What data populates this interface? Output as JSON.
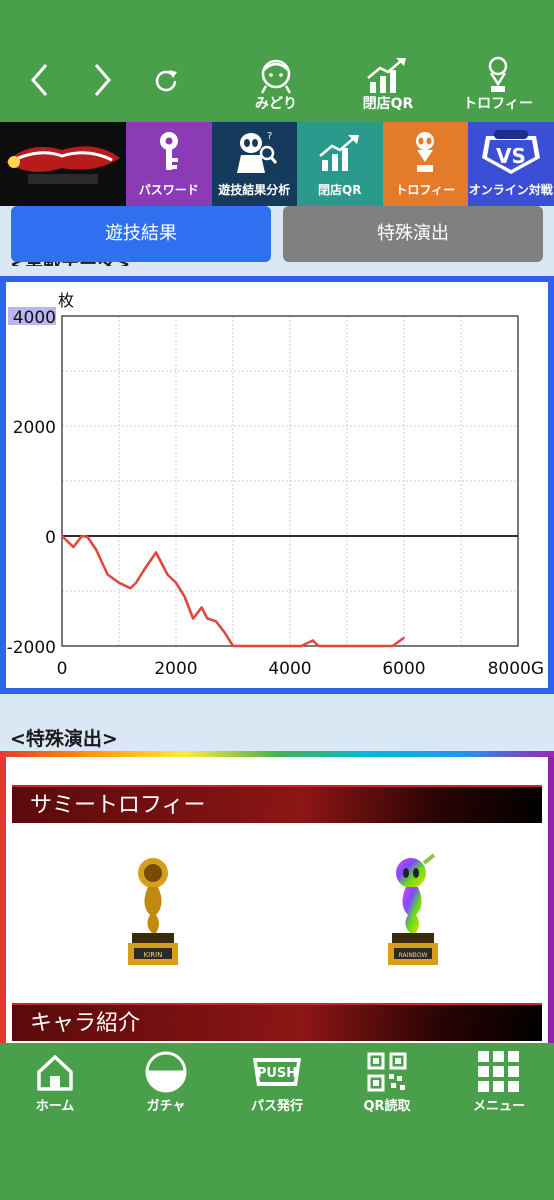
{
  "topbar": {
    "back_icon": "chevron-left-icon",
    "forward_icon": "chevron-right-icon",
    "reload_icon": "reload-icon",
    "items": [
      {
        "label": "みどり",
        "icon": "character-icon"
      },
      {
        "label": "閉店QR",
        "icon": "growth-chart-icon"
      },
      {
        "label": "トロフィー",
        "icon": "trophy-icon"
      }
    ]
  },
  "tiles": [
    {
      "label": "",
      "icon": "game-logo",
      "color": "#0d0d0d"
    },
    {
      "label": "パスワード",
      "icon": "key-icon",
      "color": "#8a3bb5"
    },
    {
      "label": "遊技結果分析",
      "icon": "alien-analysis-icon",
      "color": "#163a5c"
    },
    {
      "label": "閉店QR",
      "icon": "growth-chart-icon",
      "color": "#2a9a8c"
    },
    {
      "label": "トロフィー",
      "icon": "trophy-icon",
      "color": "#e37b2b"
    },
    {
      "label": "オンライン対戦",
      "icon": "vs-badge-icon",
      "color": "#3b4fd6"
    }
  ],
  "tabs": {
    "results": "遊技結果",
    "special": "特殊演出"
  },
  "partial_heading": "<実戦データ>",
  "chart_data": {
    "type": "line",
    "ylabel": "枚",
    "xlabel": "",
    "x_ticks": [
      "0",
      "2000",
      "4000",
      "6000",
      "8000G"
    ],
    "y_ticks": [
      "4000",
      "2000",
      "0",
      "-2000"
    ],
    "xlim": [
      0,
      8000
    ],
    "ylim": [
      -2000,
      4000
    ],
    "grid": true,
    "series": [
      {
        "color": "#e0483b",
        "x": [
          0,
          200,
          350,
          450,
          600,
          800,
          1000,
          1200,
          1300,
          1450,
          1650,
          1850,
          2000,
          2150,
          2300,
          2450,
          2550,
          2700,
          2850,
          3000,
          4200,
          4400,
          4500,
          5000,
          5800,
          6000
        ],
        "y": [
          0,
          -200,
          0,
          -20,
          -250,
          -700,
          -850,
          -950,
          -850,
          -600,
          -300,
          -700,
          -850,
          -1100,
          -1500,
          -1300,
          -1500,
          -1550,
          -1750,
          -2000,
          -2000,
          -1900,
          -2000,
          -2000,
          -2000,
          -1850
        ]
      }
    ]
  },
  "special": {
    "heading": "<特殊演出>",
    "banner_trophy": "サミートロフィー",
    "banner_chara": "キャラ紹介",
    "trophies": [
      {
        "plate": "KIRIN",
        "color": "#d4a017"
      },
      {
        "plate": "RAINBOW",
        "color": "#7e57c2"
      }
    ]
  },
  "bottomnav": [
    {
      "label": "ホーム",
      "icon": "home-icon"
    },
    {
      "label": "ガチャ",
      "icon": "gacha-icon"
    },
    {
      "label": "パス発行",
      "icon": "push-icon"
    },
    {
      "label": "QR読取",
      "icon": "qr-icon"
    },
    {
      "label": "メニュー",
      "icon": "grid-menu-icon"
    }
  ]
}
